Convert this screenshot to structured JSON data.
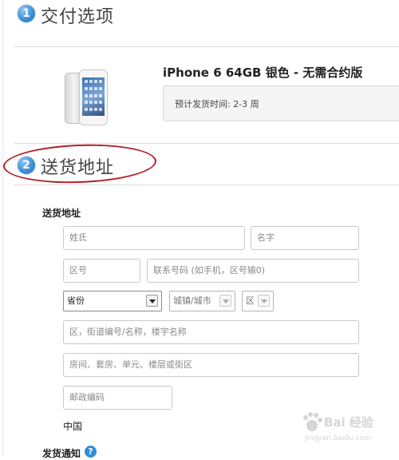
{
  "delivery": {
    "step_number": "1",
    "title": "交付选项",
    "product": {
      "name": "iPhone 6 64GB 银色 - 无需合约版",
      "ship_estimate": "预计发货时间: 2-3 周"
    }
  },
  "shipping": {
    "step_number": "2",
    "title": "送货地址",
    "annotation_color": "#b21f24",
    "section_label": "送货地址",
    "fields": {
      "last_name_placeholder": "姓氏",
      "first_name_placeholder": "名字",
      "area_code_placeholder": "区号",
      "phone_placeholder": "联系号码 (如手机，区号输0)",
      "street_placeholder": "区，街道编号/名称，楼宇名称",
      "unit_placeholder": "房间、套房、单元、楼层或街区",
      "postal_placeholder": "邮政编码"
    },
    "selects": {
      "province": "省份",
      "city": "城镇/城市",
      "district": "区"
    },
    "country": "中国"
  },
  "notification": {
    "label": "发货通知",
    "help_glyph": "?"
  },
  "watermark": {
    "text": "Bai 经验",
    "url": "jingyan.baidu.com"
  },
  "colors": {
    "step_blue": "#3f8fd6",
    "help_blue": "#2f8fd8"
  }
}
